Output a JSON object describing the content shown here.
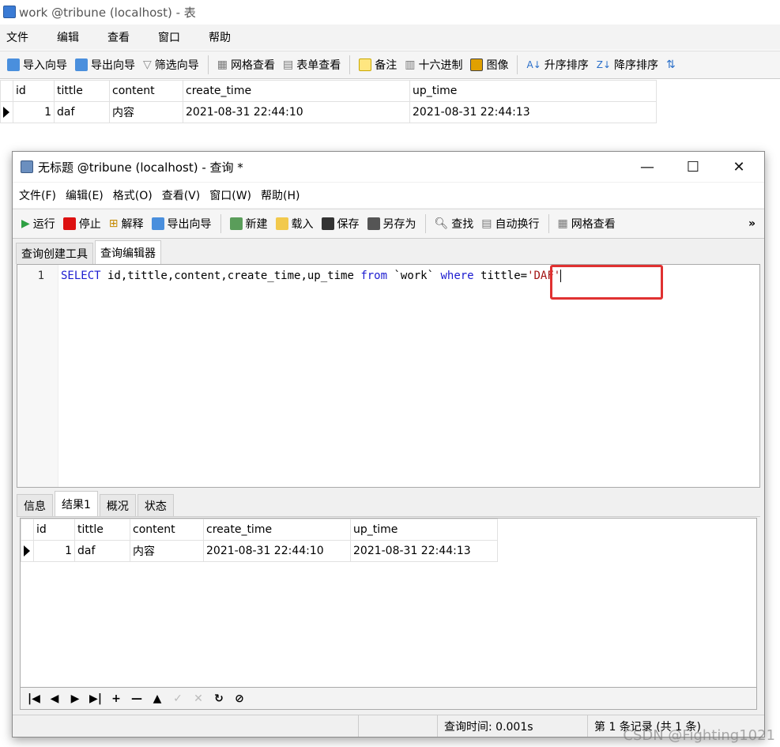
{
  "background_window": {
    "title": "work @tribune (localhost) - 表",
    "menu": [
      "文件",
      "编辑",
      "查看",
      "窗口",
      "帮助"
    ],
    "toolbar": {
      "import_wizard": "导入向导",
      "export_wizard": "导出向导",
      "filter_wizard": "筛选向导",
      "grid_view": "网格查看",
      "form_view": "表单查看",
      "memo": "备注",
      "hex": "十六进制",
      "image": "图像",
      "sort_asc": "升序排序",
      "sort_desc": "降序排序"
    },
    "grid": {
      "columns": [
        "id",
        "tittle",
        "content",
        "create_time",
        "up_time"
      ],
      "rows": [
        {
          "id": "1",
          "tittle": "daf",
          "content": "内容",
          "create_time": "2021-08-31 22:44:10",
          "up_time": "2021-08-31 22:44:13"
        }
      ]
    }
  },
  "query_window": {
    "title": "无标题 @tribune (localhost) - 查询 *",
    "controls": {
      "minimize": "—",
      "maximize": "☐",
      "close": "✕"
    },
    "menu": [
      "文件(F)",
      "编辑(E)",
      "格式(O)",
      "查看(V)",
      "窗口(W)",
      "帮助(H)"
    ],
    "toolbar": {
      "run": "运行",
      "stop": "停止",
      "explain": "解释",
      "export_wizard": "导出向导",
      "new": "新建",
      "load": "载入",
      "save": "保存",
      "save_as": "另存为",
      "find": "查找",
      "word_wrap": "自动换行",
      "grid_view": "网格查看",
      "overflow": "»"
    },
    "editor_tabs": [
      "查询创建工具",
      "查询编辑器"
    ],
    "editor": {
      "line_number": "1",
      "sql": {
        "kw_select": "SELECT",
        "columns": " id,tittle,content,create_time,up_time ",
        "kw_from": "from",
        "table": " `work` ",
        "kw_where": "where",
        "condition": " tittle=",
        "value": "'DAF'"
      }
    },
    "result_tabs": [
      "信息",
      "结果1",
      "概况",
      "状态"
    ],
    "result_grid": {
      "columns": [
        "id",
        "tittle",
        "content",
        "create_time",
        "up_time"
      ],
      "rows": [
        {
          "id": "1",
          "tittle": "daf",
          "content": "内容",
          "create_time": "2021-08-31 22:44:10",
          "up_time": "2021-08-31 22:44:13"
        }
      ]
    },
    "navigator": [
      "|◀",
      "◀",
      "▶",
      "▶|",
      "+",
      "—",
      "▲",
      "✓",
      "✕",
      "↻",
      "⊘"
    ],
    "status": {
      "query_time": "查询时间: 0.001s",
      "records": "第 1 条记录 (共 1 条)"
    }
  },
  "watermark": "CSDN @Fighting1021",
  "colors": {
    "highlight_box": "#e03131",
    "keyword": "#1b1bd0",
    "selected_header": "#d9eaf7"
  }
}
